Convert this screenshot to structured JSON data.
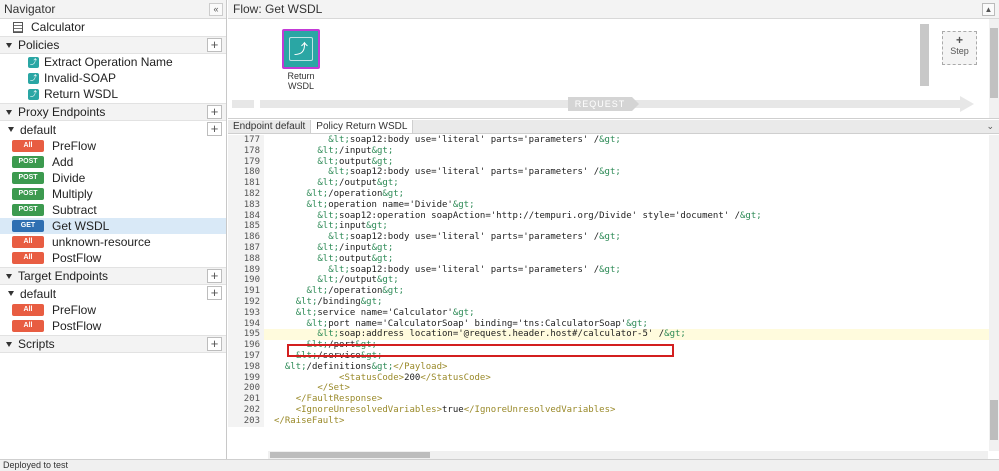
{
  "navigator": {
    "title": "Navigator",
    "collapse_icon": "«",
    "api_name": "Calculator",
    "policies_section": "Policies",
    "policies": [
      "Extract Operation Name",
      "Invalid-SOAP",
      "Return WSDL"
    ],
    "proxy_section": "Proxy Endpoints",
    "proxy_default": "default",
    "proxy_flows": [
      {
        "method": "All",
        "name": "PreFlow"
      },
      {
        "method": "POST",
        "name": "Add"
      },
      {
        "method": "POST",
        "name": "Divide"
      },
      {
        "method": "POST",
        "name": "Multiply"
      },
      {
        "method": "POST",
        "name": "Subtract"
      },
      {
        "method": "GET",
        "name": "Get WSDL"
      },
      {
        "method": "All",
        "name": "unknown-resource"
      },
      {
        "method": "All",
        "name": "PostFlow"
      }
    ],
    "target_section": "Target Endpoints",
    "target_default": "default",
    "target_flows": [
      {
        "method": "All",
        "name": "PreFlow"
      },
      {
        "method": "All",
        "name": "PostFlow"
      }
    ],
    "scripts_section": "Scripts"
  },
  "flow": {
    "title": "Flow: Get WSDL",
    "step_name": "Return\nWSDL",
    "request_label": "REQUEST",
    "add_step_plus": "+",
    "add_step_label": "Step"
  },
  "editor": {
    "tabs": [
      "Endpoint default",
      "Policy Return WSDL"
    ],
    "lines": [
      {
        "n": "177",
        "t": "          &lt;soap12:body use='literal' parts='parameters' /&gt;"
      },
      {
        "n": "178",
        "t": "        &lt;/input&gt;"
      },
      {
        "n": "179",
        "t": "        &lt;output&gt;"
      },
      {
        "n": "180",
        "t": "          &lt;soap12:body use='literal' parts='parameters' /&gt;"
      },
      {
        "n": "181",
        "t": "        &lt;/output&gt;"
      },
      {
        "n": "182",
        "t": "      &lt;/operation&gt;"
      },
      {
        "n": "183",
        "t": "      &lt;operation name='Divide'&gt;"
      },
      {
        "n": "184",
        "t": "        &lt;soap12:operation soapAction='http://tempuri.org/Divide' style='document' /&gt;"
      },
      {
        "n": "185",
        "t": "        &lt;input&gt;"
      },
      {
        "n": "186",
        "t": "          &lt;soap12:body use='literal' parts='parameters' /&gt;"
      },
      {
        "n": "187",
        "t": "        &lt;/input&gt;"
      },
      {
        "n": "188",
        "t": "        &lt;output&gt;"
      },
      {
        "n": "189",
        "t": "          &lt;soap12:body use='literal' parts='parameters' /&gt;"
      },
      {
        "n": "190",
        "t": "        &lt;/output&gt;"
      },
      {
        "n": "191",
        "t": "      &lt;/operation&gt;"
      },
      {
        "n": "192",
        "t": "    &lt;/binding&gt;"
      },
      {
        "n": "193",
        "t": "    &lt;service name='Calculator'&gt;"
      },
      {
        "n": "194",
        "t": "      &lt;port name='CalculatorSoap' binding='tns:CalculatorSoap'&gt;"
      },
      {
        "n": "195",
        "t": "        &lt;soap:address location='@request.header.host#/calculator-5' /&gt;"
      },
      {
        "n": "196",
        "t": "      &lt;/port&gt;"
      },
      {
        "n": "197",
        "t": "    &lt;/service&gt;"
      },
      {
        "n": "198",
        "t": "  &lt;/definitions&gt;</Payload>"
      },
      {
        "n": "199",
        "t": "            <StatusCode>200</StatusCode>"
      },
      {
        "n": "200",
        "t": "        </Set>"
      },
      {
        "n": "201",
        "t": "    </FaultResponse>"
      },
      {
        "n": "202",
        "t": "    <IgnoreUnresolvedVariables>true</IgnoreUnresolvedVariables>"
      },
      {
        "n": "203",
        "t": "</RaiseFault>"
      }
    ],
    "highlight_line": "195"
  },
  "status": {
    "text": "Deployed to test"
  }
}
